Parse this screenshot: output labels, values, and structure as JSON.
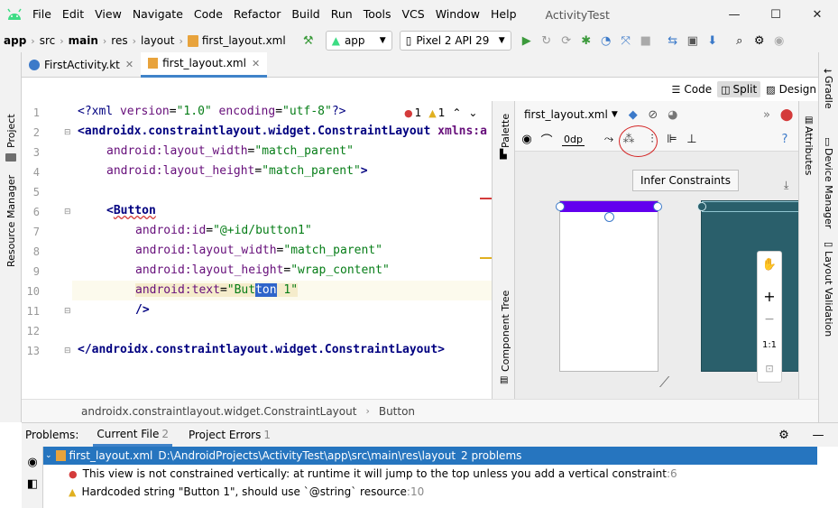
{
  "menubar": {
    "items": [
      "File",
      "Edit",
      "View",
      "Navigate",
      "Code",
      "Refactor",
      "Build",
      "Run",
      "Tools",
      "VCS",
      "Window",
      "Help"
    ],
    "window_title": "ActivityTest",
    "min_glyph": "—",
    "max_glyph": "☐",
    "close_glyph": "✕"
  },
  "navbar": {
    "breadcrumbs": [
      "app",
      "src",
      "main",
      "res",
      "layout",
      "first_layout.xml"
    ],
    "run_config": "app",
    "device": "Pixel 2 API 29"
  },
  "tabs": [
    {
      "label": "FirstActivity.kt",
      "active": false
    },
    {
      "label": "first_layout.xml",
      "active": true
    }
  ],
  "left_tools": [
    "Project",
    "Resource Manager"
  ],
  "right_tools": [
    "Gradle",
    "Device Manager",
    "Layout Validation"
  ],
  "modes": {
    "code": "Code",
    "split": "Split",
    "design": "Design"
  },
  "editor": {
    "line_numbers": [
      "1",
      "2",
      "3",
      "4",
      "5",
      "6",
      "7",
      "8",
      "9",
      "10",
      "11",
      "12",
      "13"
    ],
    "error_count": "1",
    "warning_count": "1",
    "lines": {
      "l1_a": "<?xml ",
      "l1_b": "version",
      "l1_c": "=",
      "l1_d": "\"1.0\"",
      "l1_e": " encoding",
      "l1_f": "=",
      "l1_g": "\"utf-8\"",
      "l1_h": "?>",
      "l2_a": "<androidx.constraintlayout.widget.ConstraintLayout",
      "l2_b": " xmlns:a",
      "l3_a": "android:",
      "l3_b": "layout_width",
      "l3_c": "=",
      "l3_d": "\"match_parent\"",
      "l4_a": "android:",
      "l4_b": "layout_height",
      "l4_c": "=",
      "l4_d": "\"match_parent\"",
      "l4_e": ">",
      "l6_a": "<",
      "l6_b": "Button",
      "l7_a": "android:",
      "l7_b": "id",
      "l7_c": "=",
      "l7_d": "\"@+id/button1\"",
      "l8_a": "android:",
      "l8_b": "layout_width",
      "l8_c": "=",
      "l8_d": "\"match_parent\"",
      "l9_a": "android:",
      "l9_b": "layout_height",
      "l9_c": "=",
      "l9_d": "\"wrap_content\"",
      "l10_a": "android:",
      "l10_b": "text",
      "l10_c": "=",
      "l10_d": "\"But",
      "l10_e": "ton",
      "l10_f": " 1\"",
      "l11_a": "/>",
      "l13_a": "</androidx.constraintlayout.widget.ConstraintLayout",
      "l13_b": ">"
    }
  },
  "editor_breadcrumb": [
    "androidx.constraintlayout.widget.ConstraintLayout",
    "Button"
  ],
  "design": {
    "file_select": "first_layout.xml",
    "margin_value": "0dp",
    "tooltip": "Infer Constraints",
    "palette_label": "Palette",
    "component_tree_label": "Component Tree",
    "attributes_label": "Attributes",
    "zoom_ratio": "1:1",
    "zoom_in": "+",
    "zoom_out": "−",
    "accent_color": "#6200ee",
    "blueprint_color": "#2a5f6b"
  },
  "problems": {
    "label": "Problems:",
    "tabs": [
      {
        "label": "Current File",
        "count": "2"
      },
      {
        "label": "Project Errors",
        "count": "1"
      }
    ],
    "file_row": {
      "name": "first_layout.xml",
      "path": "D:\\AndroidProjects\\ActivityTest\\app\\src\\main\\res\\layout",
      "summary": "2 problems"
    },
    "items": [
      {
        "severity": "error",
        "text": "This view is not constrained vertically: at runtime it will jump to the top unless you add a vertical constraint",
        "loc": ":6"
      },
      {
        "severity": "warning",
        "text": "Hardcoded string \"Button 1\", should use `@string` resource",
        "loc": ":10"
      }
    ]
  }
}
